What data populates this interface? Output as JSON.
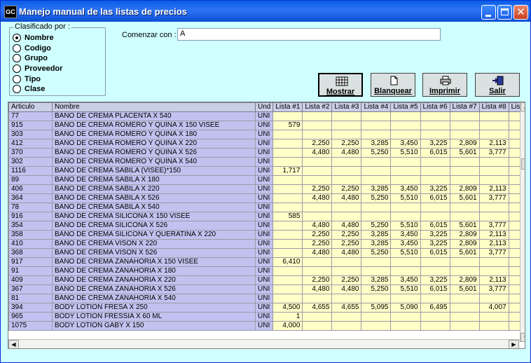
{
  "window": {
    "title": "Manejo manual de las listas de precios",
    "icon_text": "GC"
  },
  "group": {
    "label": "Clasificado por :",
    "options": [
      {
        "label": "Nombre",
        "selected": true
      },
      {
        "label": "Codigo",
        "selected": false
      },
      {
        "label": "Grupo",
        "selected": false
      },
      {
        "label": "Proveedor",
        "selected": false
      },
      {
        "label": "Tipo",
        "selected": false
      },
      {
        "label": "Clase",
        "selected": false
      }
    ]
  },
  "search": {
    "label": "Comenzar con :",
    "value": "A"
  },
  "buttons": {
    "mostrar": "Mostrar",
    "blanquear": "Blanquear",
    "imprimir": "Imprimir",
    "salir": "Salir"
  },
  "table": {
    "columns": [
      "Articulo",
      "Nombre",
      "Und",
      "Lista #1",
      "Lista #2",
      "Lista #3",
      "Lista #4",
      "Lista #5",
      "Lista #6",
      "Lista #7",
      "Lista #8",
      "Lis"
    ],
    "rows": [
      [
        "77",
        "BAÑO DE CREMA PLACENTA X 540",
        "UNI",
        "",
        "",
        "",
        "",
        "",
        "",
        "",
        ""
      ],
      [
        "915",
        "BAÑO DE CREMA ROMERO Y QUINA X 150 VISEE",
        "UNI",
        "579",
        "",
        "",
        "",
        "",
        "",
        "",
        ""
      ],
      [
        "303",
        "BAÑO DE CREMA ROMERO Y QUINA X 180",
        "UNI",
        "",
        "",
        "",
        "",
        "",
        "",
        "",
        ""
      ],
      [
        "412",
        "BAÑO DE CREMA ROMERO Y QUINA X 220",
        "UNI",
        "",
        "2,250",
        "2,250",
        "3,285",
        "3,450",
        "3,225",
        "2,809",
        "2,113"
      ],
      [
        "370",
        "BAÑO DE CREMA ROMERO Y QUINA X 526",
        "UNI",
        "",
        "4,480",
        "4,480",
        "5,250",
        "5,510",
        "6,015",
        "5,601",
        "3,777"
      ],
      [
        "302",
        "BAÑO DE CREMA ROMERO Y QUINA X 540",
        "UNI",
        "",
        "",
        "",
        "",
        "",
        "",
        "",
        ""
      ],
      [
        "1116",
        "BAÑO DE CREMA SABILA (VISEE)*150",
        "UNI",
        "1,717",
        "",
        "",
        "",
        "",
        "",
        "",
        ""
      ],
      [
        "89",
        "BAÑO DE CREMA SABILA X 180",
        "UNI",
        "",
        "",
        "",
        "",
        "",
        "",
        "",
        ""
      ],
      [
        "406",
        "BAÑO DE CREMA SABILA X 220",
        "UNI",
        "",
        "2,250",
        "2,250",
        "3,285",
        "3,450",
        "3,225",
        "2,809",
        "2,113"
      ],
      [
        "364",
        "BAÑO DE CREMA SABILA X 526",
        "UNI",
        "",
        "4,480",
        "4,480",
        "5,250",
        "5,510",
        "6,015",
        "5,601",
        "3,777"
      ],
      [
        "78",
        "BAÑO DE CREMA SABILA X 540",
        "UNI",
        "",
        "",
        "",
        "",
        "",
        "",
        "",
        ""
      ],
      [
        "916",
        "BAÑO DE CREMA SILICONA X 150 VISEE",
        "UNI",
        "585",
        "",
        "",
        "",
        "",
        "",
        "",
        ""
      ],
      [
        "354",
        "BAÑO DE CREMA SILICONA X 526",
        "UNI",
        "",
        "4,480",
        "4,480",
        "5,250",
        "5,510",
        "6,015",
        "5,601",
        "3,777"
      ],
      [
        "358",
        "BAÑO DE CREMA SILICONA Y QUERATINA X 220",
        "UNI",
        "",
        "2,250",
        "2,250",
        "3,285",
        "3,450",
        "3,225",
        "2,809",
        "2,113"
      ],
      [
        "410",
        "BAÑO DE CREMA VISON X 220",
        "UNI",
        "",
        "2,250",
        "2,250",
        "3,285",
        "3,450",
        "3,225",
        "2,809",
        "2,113"
      ],
      [
        "368",
        "BAÑO DE CREMA VISON X 526",
        "UNI",
        "",
        "4,480",
        "4,480",
        "5,250",
        "5,510",
        "6,015",
        "5,601",
        "3,777"
      ],
      [
        "917",
        "BAÑO DE CREMA ZANAHORIA X 150 VISEE",
        "UNI",
        "6,410",
        "",
        "",
        "",
        "",
        "",
        "",
        ""
      ],
      [
        "91",
        "BAÑO DE CREMA ZANAHORIA X 180",
        "UNI",
        "",
        "",
        "",
        "",
        "",
        "",
        "",
        ""
      ],
      [
        "409",
        "BAÑO DE CREMA ZANAHORIA X 220",
        "UNI",
        "",
        "2,250",
        "2,250",
        "3,285",
        "3,450",
        "3,225",
        "2,809",
        "2,113"
      ],
      [
        "367",
        "BAÑO DE CREMA ZANAHORIA X 526",
        "UNI",
        "",
        "4,480",
        "4,480",
        "5,250",
        "5,510",
        "6,015",
        "5,601",
        "3,777"
      ],
      [
        "81",
        "BAÑO DE CREMA ZANAHORIA X 540",
        "UNI",
        "",
        "",
        "",
        "",
        "",
        "",
        "",
        ""
      ],
      [
        "394",
        "BODY LOTION FRESA X 250",
        "UNI",
        "4,500",
        "4,655",
        "4,655",
        "5,095",
        "5,090",
        "6,495",
        "",
        "4,007"
      ],
      [
        "965",
        "BODY LOTION FRESSIA X 60 ML",
        "UNI",
        "1",
        "",
        "",
        "",
        "",
        "",
        "",
        ""
      ],
      [
        "1075",
        "BODY LOTION GABY X 150",
        "UNI",
        "4,000",
        "",
        "",
        "",
        "",
        "",
        "",
        ""
      ]
    ]
  },
  "colors": {
    "title_bar": "#0a5ee6",
    "background": "#cfffff",
    "label_cell": "#c2c2f0",
    "price_cell": "#ffffc8",
    "header": "#c9d0e6"
  },
  "icons": {
    "mostrar": "grid-icon",
    "blanquear": "blank-page-icon",
    "imprimir": "printer-icon",
    "salir": "exit-door-icon"
  }
}
